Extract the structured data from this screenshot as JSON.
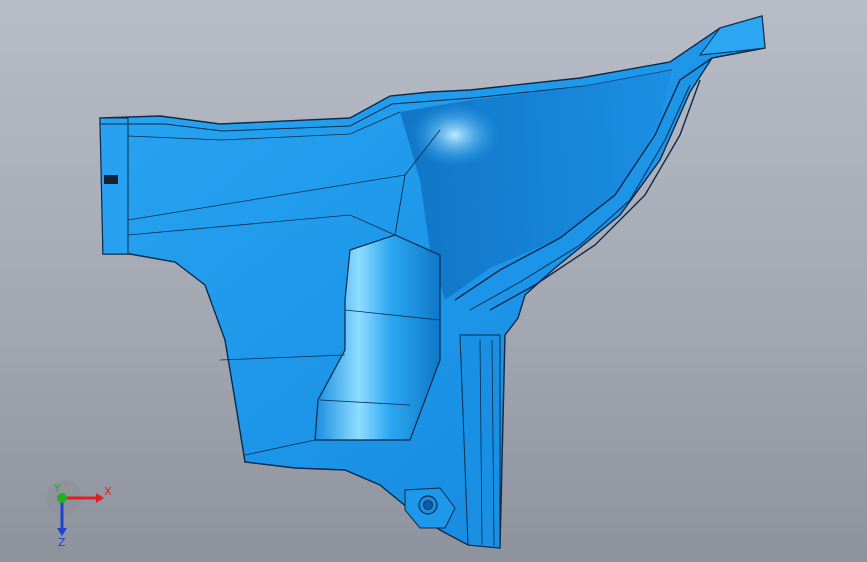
{
  "viewport": {
    "background_top": "#b8bcc6",
    "background_bottom": "#8e929c"
  },
  "model": {
    "part_color": "#1e9ef0",
    "highlight_color": "#7fd8ff",
    "shadow_color": "#0a6fc4",
    "edge_color": "#0b2a4a"
  },
  "triad": {
    "x_label": "X",
    "y_label": "Y",
    "z_label": "Z",
    "x_color": "#e02020",
    "y_color": "#20b020",
    "z_color": "#2040d0"
  }
}
